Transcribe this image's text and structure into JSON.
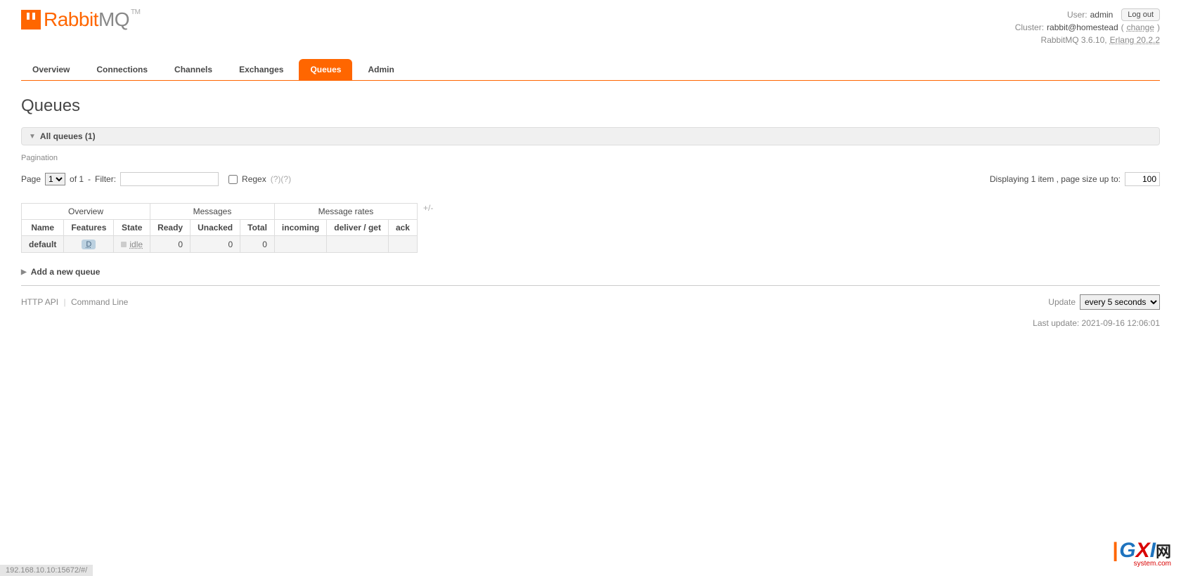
{
  "logo": {
    "brand_part1": "Rabbit",
    "brand_part2": "MQ",
    "tm": "TM"
  },
  "header": {
    "user_label": "User:",
    "user_name": "admin",
    "logout": "Log out",
    "cluster_label": "Cluster:",
    "cluster_name": "rabbit@homestead",
    "change": "change",
    "version": "RabbitMQ 3.6.10,",
    "erlang": "Erlang 20.2.2"
  },
  "tabs": [
    "Overview",
    "Connections",
    "Channels",
    "Exchanges",
    "Queues",
    "Admin"
  ],
  "active_tab": 4,
  "page_title": "Queues",
  "section_all": "All queues (1)",
  "pagination": {
    "label": "Pagination",
    "page_word": "Page",
    "page_select": "1",
    "of_word": "of 1",
    "dash": " - ",
    "filter_label": "Filter:",
    "regex_label": "Regex",
    "help": "(?)(?)",
    "displaying": "Displaying 1 item , page size up to:",
    "page_size": "100"
  },
  "table": {
    "groups": [
      "Overview",
      "Messages",
      "Message rates"
    ],
    "headers": [
      "Name",
      "Features",
      "State",
      "Ready",
      "Unacked",
      "Total",
      "incoming",
      "deliver / get",
      "ack"
    ],
    "row": {
      "name": "default",
      "feature_badge": "D",
      "state": "idle",
      "ready": "0",
      "unacked": "0",
      "total": "0",
      "incoming": "",
      "deliver": "",
      "ack": ""
    },
    "plusminus": "+/-"
  },
  "add_queue": "Add a new queue",
  "footer": {
    "api": "HTTP API",
    "cmd": "Command Line",
    "update_label": "Update",
    "update_select": "every 5 seconds",
    "last_update": "Last update: 2021-09-16 12:06:01"
  },
  "status_url": "192.168.10.10:15672/#/",
  "watermark": {
    "g": "G",
    "x": "X",
    "i": "I",
    "net": "网",
    "sub": "system.com"
  }
}
